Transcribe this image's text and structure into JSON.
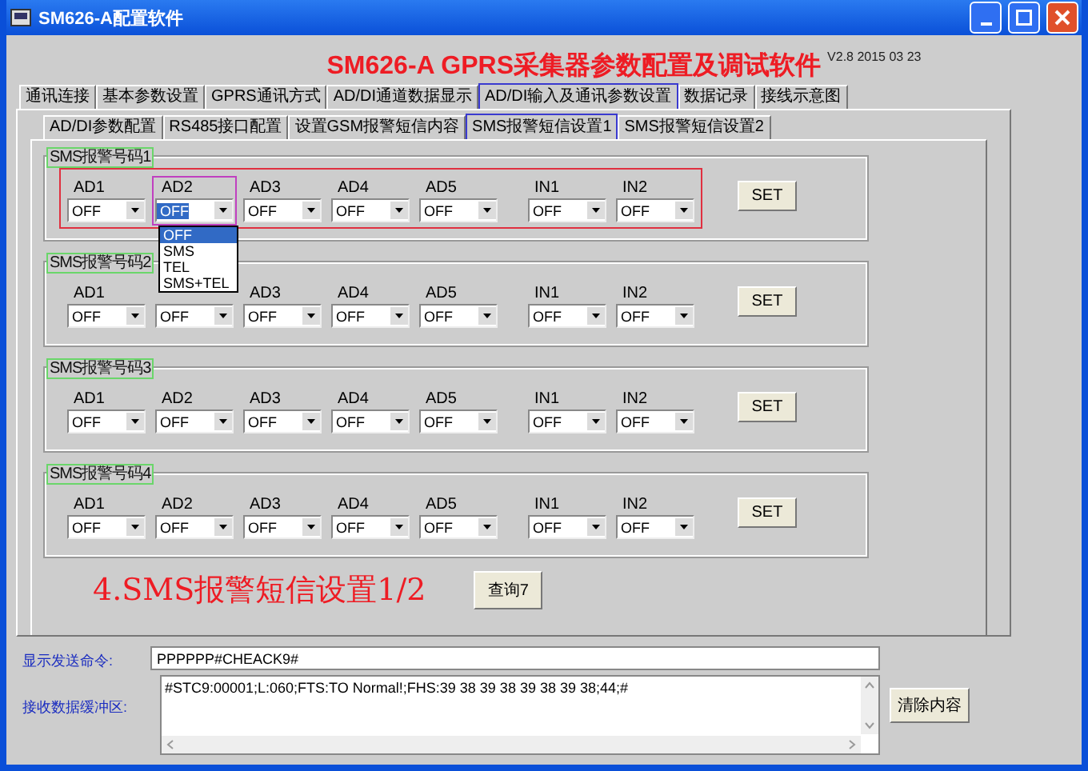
{
  "window": {
    "title": "SM626-A配置软件"
  },
  "header": {
    "title": "SM626-A GPRS采集器参数配置及调试软件",
    "version": "V2.8 2015 03 23"
  },
  "tabs": [
    {
      "label": "通讯连接",
      "selected": false
    },
    {
      "label": "基本参数设置",
      "selected": false
    },
    {
      "label": "GPRS通讯方式",
      "selected": false
    },
    {
      "label": "AD/DI通道数据显示",
      "selected": false
    },
    {
      "label": "AD/DI输入及通讯参数设置",
      "selected": true
    },
    {
      "label": "数据记录",
      "selected": false
    },
    {
      "label": "接线示意图",
      "selected": false
    }
  ],
  "subtabs": [
    {
      "label": "AD/DI参数配置",
      "selected": false
    },
    {
      "label": "RS485接口配置",
      "selected": false
    },
    {
      "label": "设置GSM报警短信内容",
      "selected": false
    },
    {
      "label": "SMS报警短信设置1",
      "selected": true
    },
    {
      "label": "SMS报警短信设置2",
      "selected": false
    }
  ],
  "groups": [
    {
      "title": "SMS报警号码1",
      "highlighted": true,
      "button": "SET",
      "fields": [
        {
          "label": "AD1",
          "value": "OFF",
          "focused": false
        },
        {
          "label": "AD2",
          "value": "OFF",
          "focused": true,
          "options": [
            {
              "label": "OFF",
              "selected": true
            },
            {
              "label": "SMS",
              "selected": false
            },
            {
              "label": "TEL",
              "selected": false
            },
            {
              "label": "SMS+TEL",
              "selected": false
            }
          ]
        },
        {
          "label": "AD3",
          "value": "OFF",
          "focused": false
        },
        {
          "label": "AD4",
          "value": "OFF",
          "focused": false
        },
        {
          "label": "AD5",
          "value": "OFF",
          "focused": false
        },
        {
          "label": "IN1",
          "value": "OFF",
          "focused": false
        },
        {
          "label": "IN2",
          "value": "OFF",
          "focused": false
        }
      ]
    },
    {
      "title": "SMS报警号码2",
      "highlighted": false,
      "button": "SET",
      "fields": [
        {
          "label": "AD1",
          "value": "OFF",
          "focused": false
        },
        {
          "value": "OFF",
          "focused": false
        },
        {
          "label": "AD3",
          "value": "OFF",
          "focused": false
        },
        {
          "label": "AD4",
          "value": "OFF",
          "focused": false
        },
        {
          "label": "AD5",
          "value": "OFF",
          "focused": false
        },
        {
          "label": "IN1",
          "value": "OFF",
          "focused": false
        },
        {
          "label": "IN2",
          "value": "OFF",
          "focused": false
        }
      ]
    },
    {
      "title": "SMS报警号码3",
      "highlighted": false,
      "button": "SET",
      "fields": [
        {
          "label": "AD1",
          "value": "OFF",
          "focused": false
        },
        {
          "label": "AD2",
          "value": "OFF",
          "focused": false
        },
        {
          "label": "AD3",
          "value": "OFF",
          "focused": false
        },
        {
          "label": "AD4",
          "value": "OFF",
          "focused": false
        },
        {
          "label": "AD5",
          "value": "OFF",
          "focused": false
        },
        {
          "label": "IN1",
          "value": "OFF",
          "focused": false
        },
        {
          "label": "IN2",
          "value": "OFF",
          "focused": false
        }
      ]
    },
    {
      "title": "SMS报警号码4",
      "highlighted": false,
      "button": "SET",
      "fields": [
        {
          "label": "AD1",
          "value": "OFF",
          "focused": false
        },
        {
          "label": "AD2",
          "value": "OFF",
          "focused": false
        },
        {
          "label": "AD3",
          "value": "OFF",
          "focused": false
        },
        {
          "label": "AD4",
          "value": "OFF",
          "focused": false
        },
        {
          "label": "AD5",
          "value": "OFF",
          "focused": false
        },
        {
          "label": "IN1",
          "value": "OFF",
          "focused": false
        },
        {
          "label": "IN2",
          "value": "OFF",
          "focused": false
        }
      ]
    }
  ],
  "caption": "4.SMS报警短信设置1/2",
  "query_button": "查询7",
  "send": {
    "label": "显示发送命令:",
    "value": "PPPPPP#CHEACK9#"
  },
  "receive": {
    "label": "接收数据缓冲区:",
    "value": "#STC9:00001;L:060;FTS:TO Normal!;FHS:39 38 39 38 39 38 39 38;44;#"
  },
  "clear_button": "清除内容"
}
